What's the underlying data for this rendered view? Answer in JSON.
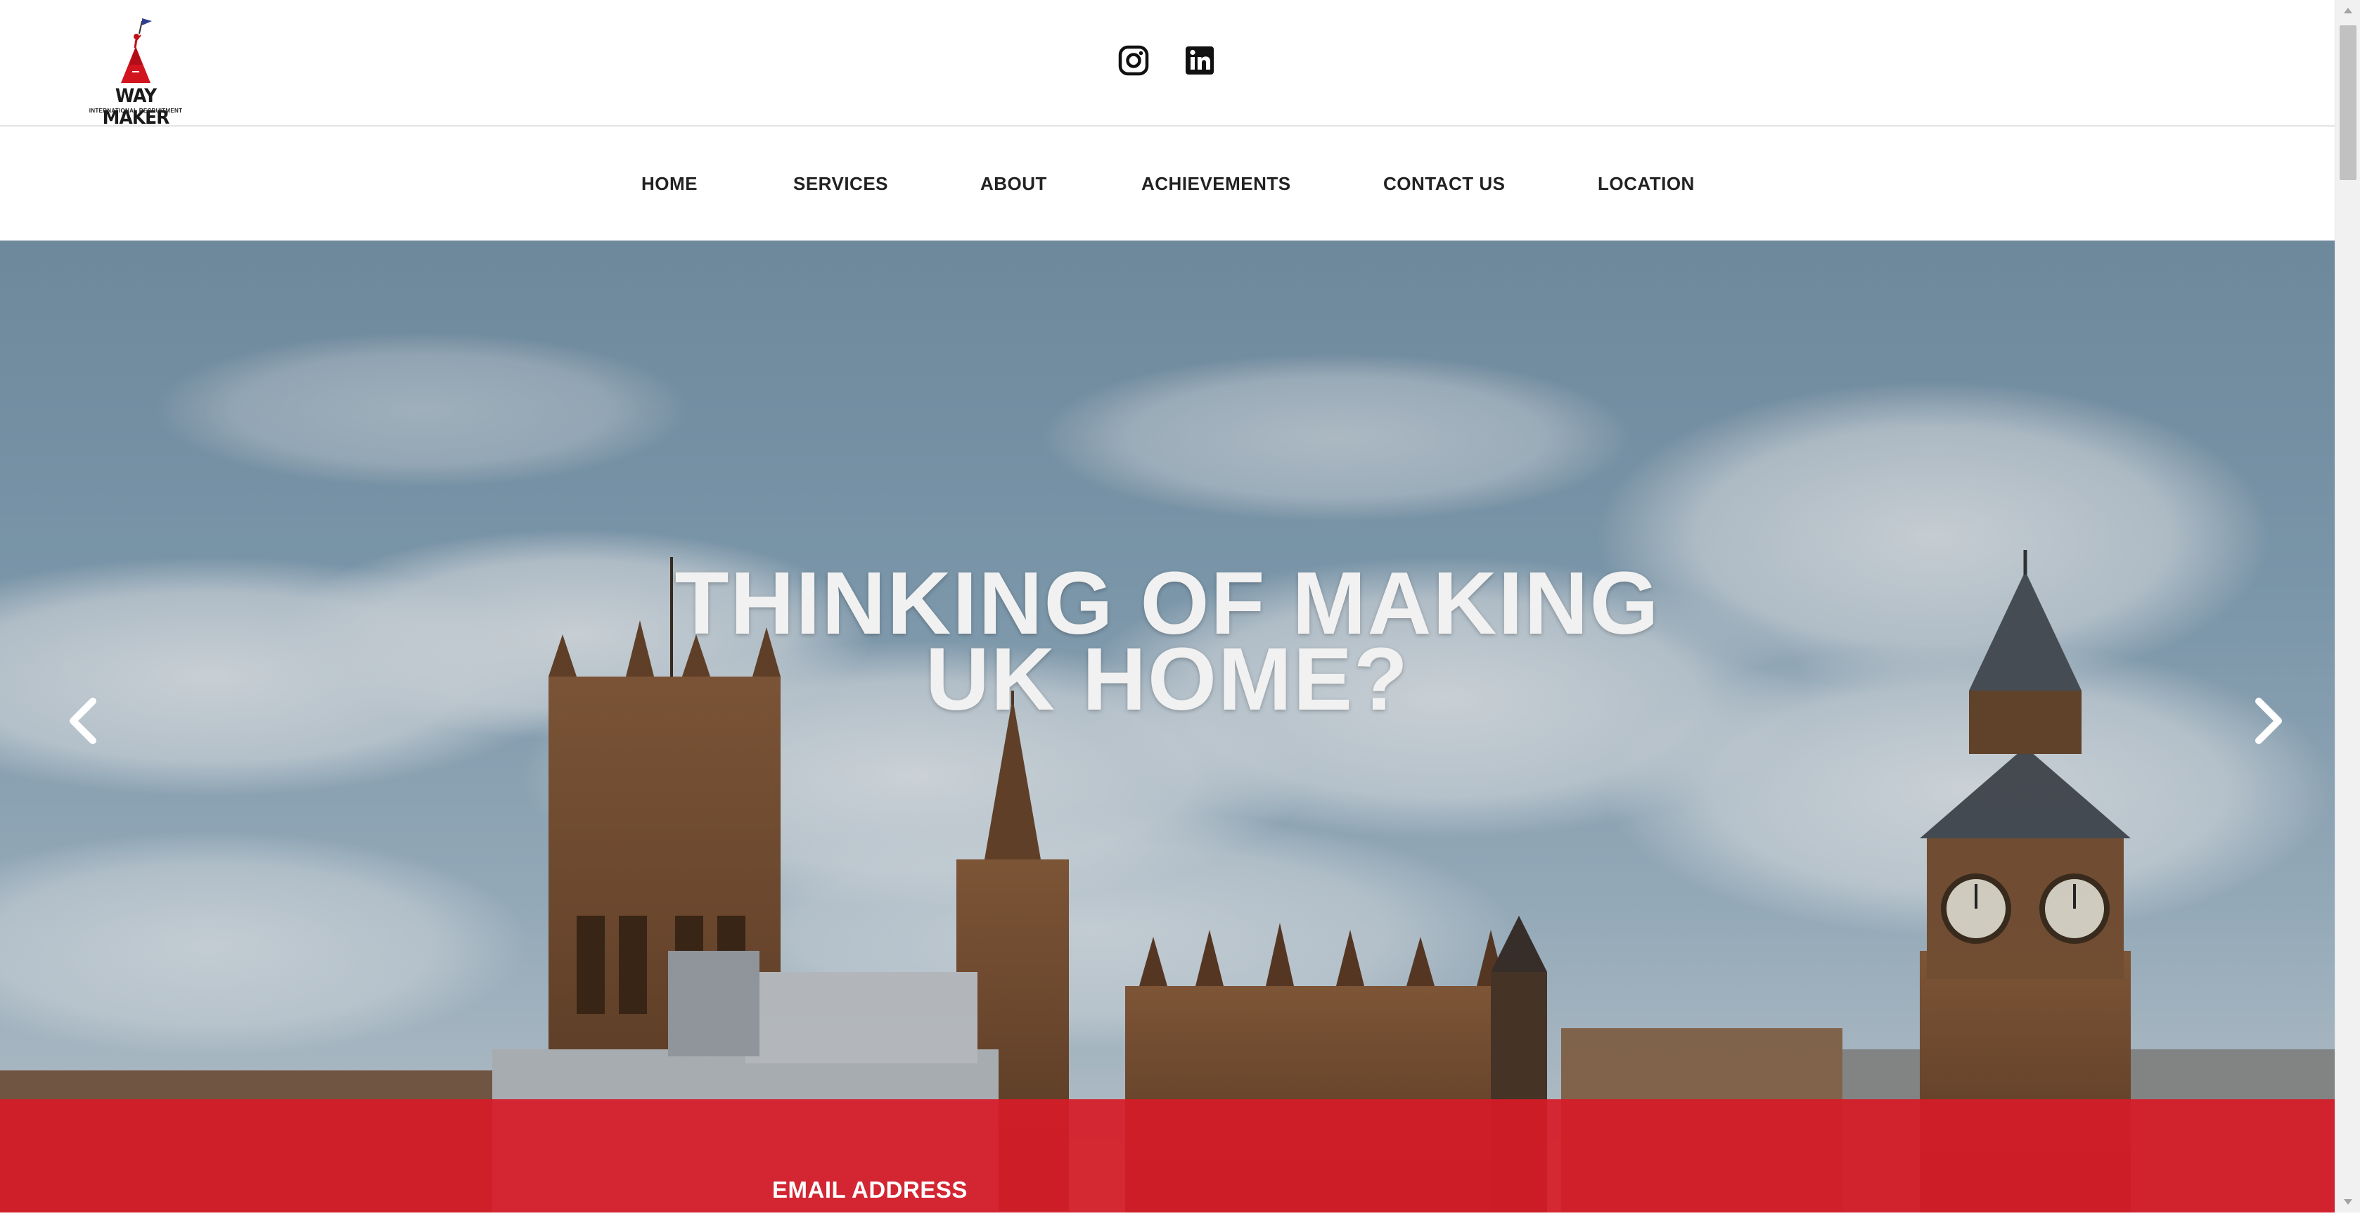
{
  "brand": {
    "name": "WAY MAKER",
    "tagline": "INTERNATIONAL RECRUITMENT"
  },
  "social": [
    {
      "icon": "instagram-icon"
    },
    {
      "icon": "linkedin-icon"
    }
  ],
  "nav": {
    "items": [
      {
        "label": "HOME"
      },
      {
        "label": "SERVICES"
      },
      {
        "label": "ABOUT"
      },
      {
        "label": "ACHIEVEMENTS"
      },
      {
        "label": "CONTACT US"
      },
      {
        "label": "LOCATION"
      }
    ]
  },
  "hero": {
    "title_line1": "THINKING OF MAKING",
    "title_line2": "UK HOME?",
    "prev_icon": "chevron-left-icon",
    "next_icon": "chevron-right-icon"
  },
  "subscribe": {
    "email_label": "EMAIL ADDRESS"
  },
  "colors": {
    "accent_red": "#d61c28",
    "nav_text": "#222222",
    "hero_text": "#f1f1f1"
  }
}
